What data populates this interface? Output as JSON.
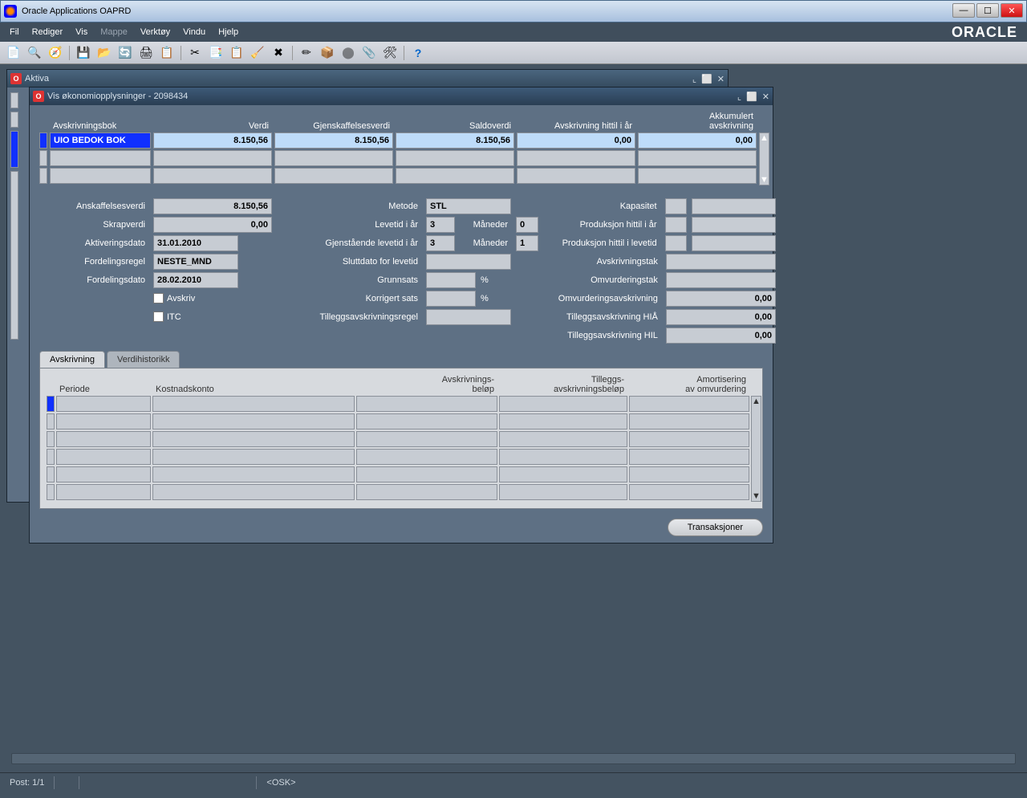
{
  "os_window": {
    "title": "Oracle Applications OAPRD"
  },
  "menu": {
    "fil": "Fil",
    "rediger": "Rediger",
    "vis": "Vis",
    "mappe": "Mappe",
    "verktoy": "Verktøy",
    "vindu": "Vindu",
    "hjelp": "Hjelp"
  },
  "brand": "ORACLE",
  "mdi_back": {
    "title": "Aktiva"
  },
  "mdi_front": {
    "title": "Vis økonomiopplysninger - 2098434"
  },
  "grid": {
    "headers": {
      "bok": "Avskrivningsbok",
      "verdi": "Verdi",
      "gjen": "Gjenskaffelsesverdi",
      "saldo": "Saldoverdi",
      "avskr": "Avskrivning hittil i år",
      "akk1": "Akkumulert",
      "akk2": "avskrivning"
    },
    "row1": {
      "bok": "UIO BEDOK BOK",
      "verdi": "8.150,56",
      "gjen": "8.150,56",
      "saldo": "8.150,56",
      "avskr": "0,00",
      "akk": "0,00"
    }
  },
  "form_left": {
    "ansk_label": "Anskaffelsesverdi",
    "ansk": "8.150,56",
    "skrap_label": "Skrapverdi",
    "skrap": "0,00",
    "aktdato_label": "Aktiveringsdato",
    "aktdato": "31.01.2010",
    "fregel_label": "Fordelingsregel",
    "fregel": "NESTE_MND",
    "fdato_label": "Fordelingsdato",
    "fdato": "28.02.2010",
    "avskriv_label": "Avskriv",
    "itc_label": "ITC"
  },
  "form_mid": {
    "metode_label": "Metode",
    "metode": "STL",
    "levetid_label": "Levetid i år",
    "levetid_aar": "3",
    "maneder_label": "Måneder",
    "levetid_mnd": "0",
    "gjen_label": "Gjenstående levetid i år",
    "gjen_aar": "3",
    "gjen_mnd": "1",
    "slutt_label": "Sluttdato for levetid",
    "grunn_label": "Grunnsats",
    "pct": "%",
    "korr_label": "Korrigert sats",
    "tillegg_label": "Tilleggsavskrivningsregel"
  },
  "form_right": {
    "kap_label": "Kapasitet",
    "prodaar_label": "Produksjon hittil i år",
    "prodlev_label": "Produksjon hittil i levetid",
    "avtak_label": "Avskrivningstak",
    "omtak_label": "Omvurderingstak",
    "omav_label": "Omvurderingsavskrivning",
    "omav": "0,00",
    "tilhia_label": "Tilleggsavskrivning HIÅ",
    "tilhia": "0,00",
    "tilhil_label": "Tilleggsavskrivning HIL",
    "tilhil": "0,00"
  },
  "tabs": {
    "t1": "Avskrivning",
    "t2": "Verdihistorikk"
  },
  "table": {
    "periode": "Periode",
    "kost": "Kostnadskonto",
    "avb1": "Avskrivnings-",
    "avb2": "beløp",
    "til1": "Tilleggs-",
    "til2": "avskrivningsbeløp",
    "am1": "Amortisering",
    "am2": "av omvurdering"
  },
  "button": {
    "trans": "Transaksjoner"
  },
  "status": {
    "post": "Post: 1/1",
    "osk": "<OSK>"
  }
}
